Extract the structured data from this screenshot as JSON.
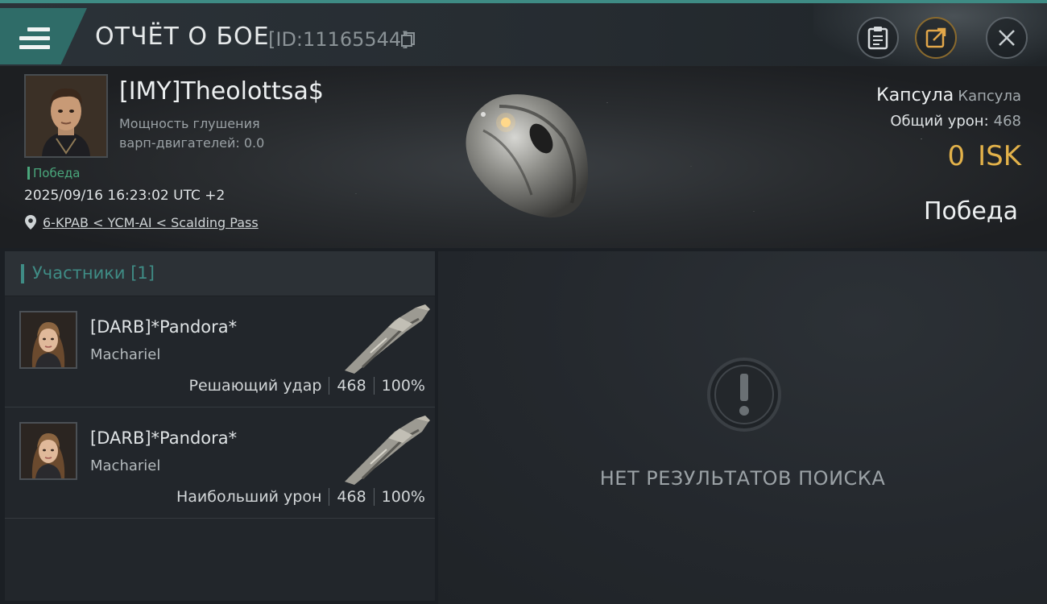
{
  "header": {
    "title": "ОТЧЁТ О БОЕ",
    "report_id": "[ID:11165544]",
    "icons": {
      "menu": "hamburger-menu-icon",
      "copy": "copy-icon",
      "clipboard": "clipboard-icon",
      "share": "share-external-icon",
      "close": "close-icon"
    }
  },
  "victim": {
    "name": "[IMY]Theolottsa$",
    "warp_label": "Мощность глушения",
    "warp_value": "варп-двигателей: 0.0",
    "tag": "Победа",
    "timestamp": "2025/09/16 16:23:02 UTC +2",
    "location": "6-KPAB < YCM-AI < Scalding Pass",
    "ship_class": "Капсула",
    "ship_name": "Капсула",
    "total_damage_label": "Общий урон:",
    "total_damage": "468",
    "isk_value": "0",
    "isk_unit": "ISK",
    "result": "Победа"
  },
  "participants": {
    "title": "Участники [1]",
    "items": [
      {
        "name": "[DARB]*Pandora*",
        "ship": "Machariel",
        "role": "Решающий удар",
        "damage": "468",
        "percent": "100%"
      },
      {
        "name": "[DARB]*Pandora*",
        "ship": "Machariel",
        "role": "Наибольший урон",
        "damage": "468",
        "percent": "100%"
      }
    ]
  },
  "results_panel": {
    "empty_text": "НЕТ РЕЗУЛЬТАТОВ ПОИСКА",
    "icon": "exclamation-circle-icon"
  },
  "colors": {
    "accent_teal": "#3f8c85",
    "isk_gold": "#e3b24a",
    "victory_green": "#4aa77c"
  }
}
